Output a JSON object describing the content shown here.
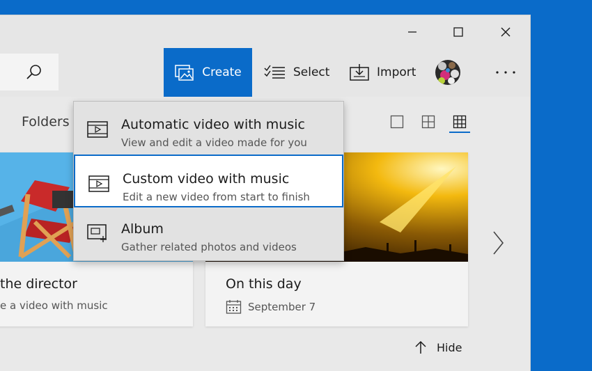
{
  "window_controls": {
    "minimize": "minimize-icon",
    "maximize": "maximize-icon",
    "close": "close-icon"
  },
  "toolbar": {
    "create_label": "Create",
    "select_label": "Select",
    "import_label": "Import"
  },
  "section": {
    "folders_label": "Folders"
  },
  "menu": {
    "items": [
      {
        "title": "Automatic video with music",
        "subtitle": "View and edit a video made for you"
      },
      {
        "title": "Custom video with music",
        "subtitle": "Edit a new video from start to finish"
      },
      {
        "title": "Album",
        "subtitle": "Gather related photos and videos"
      }
    ]
  },
  "cards": [
    {
      "title": "the director",
      "subtitle": "e a video with music"
    },
    {
      "title": "On this day",
      "subtitle": "September 7"
    }
  ],
  "hide_label": "Hide",
  "colors": {
    "accent": "#0a6bc9",
    "desktop": "#0a6bc9"
  }
}
